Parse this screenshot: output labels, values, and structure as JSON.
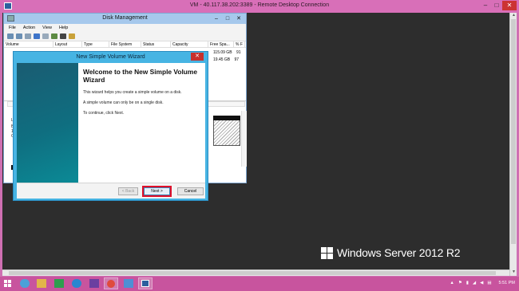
{
  "rdp": {
    "title": "VM - 40.117.38.202:3389 - Remote Desktop Connection",
    "minimize": "–",
    "restore": "□",
    "close": "✕"
  },
  "disk_management": {
    "title": "Disk Management",
    "menu": [
      "File",
      "Action",
      "View",
      "Help"
    ],
    "columns": [
      "Volume",
      "Layout",
      "Type",
      "File System",
      "Status",
      "Capacity",
      "Free Spa...",
      "% F"
    ],
    "rows": [
      {
        "free": "115.09 GB",
        "pct": "91"
      },
      {
        "free": "19.45 GB",
        "pct": "97"
      }
    ],
    "lower_labels": [
      "L",
      "B",
      "1",
      "C"
    ]
  },
  "wizard": {
    "title": "New Simple Volume Wizard",
    "close": "✕",
    "heading": "Welcome to the New Simple Volume Wizard",
    "p1": "This wizard helps you create a simple volume on a disk.",
    "p2": "A simple volume can only be on a single disk.",
    "p3": "To continue, click Next.",
    "back": "< Back",
    "next": "Next >",
    "cancel": "Cancel"
  },
  "brand": {
    "text": "Windows Server 2012 R2"
  },
  "taskbar": {
    "time": "5:51 PM"
  },
  "colors": {
    "accent": "#d86fb8",
    "wizard_frame": "#47b4e3",
    "highlight": "#e0102a"
  }
}
